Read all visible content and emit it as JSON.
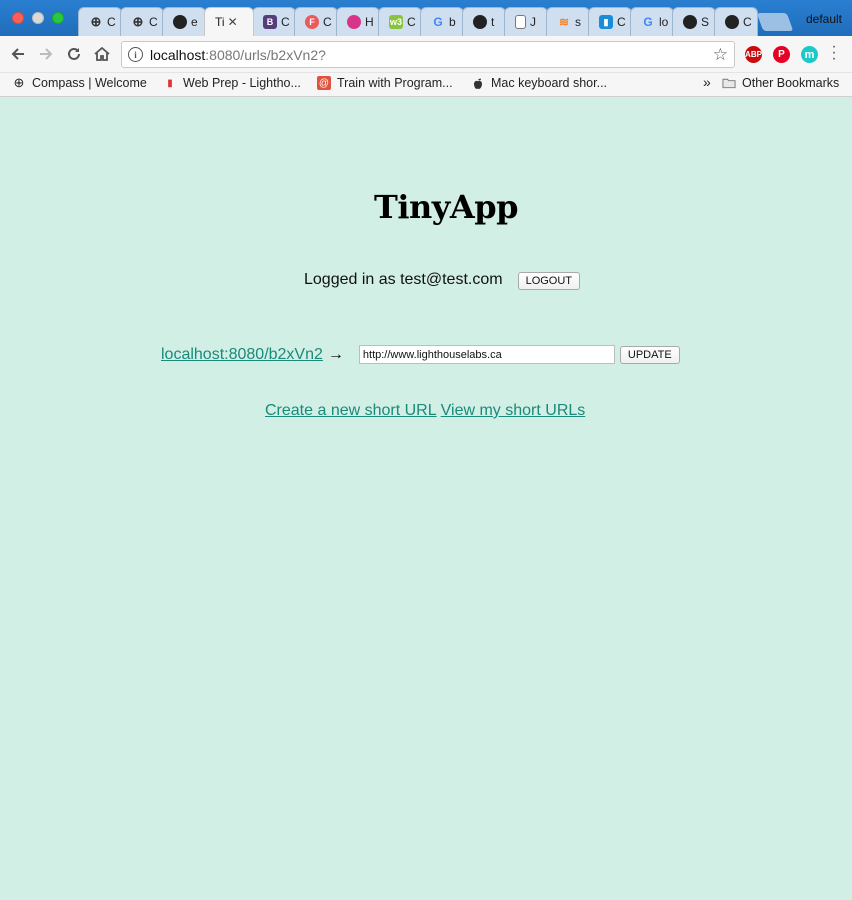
{
  "browser": {
    "tabs": [
      {
        "icon": "compass-icon",
        "label": "C"
      },
      {
        "icon": "compass-icon",
        "label": "C"
      },
      {
        "icon": "github-icon",
        "label": "e"
      },
      {
        "icon": "page-icon",
        "label": "Ti",
        "active": true
      },
      {
        "icon": "bootstrap-icon",
        "label": "C"
      },
      {
        "icon": "f-icon",
        "label": "C"
      },
      {
        "icon": "firefox-icon",
        "label": "H"
      },
      {
        "icon": "w3-icon",
        "label": "C"
      },
      {
        "icon": "google-icon",
        "label": "b"
      },
      {
        "icon": "github-icon",
        "label": "t"
      },
      {
        "icon": "document-icon",
        "label": "J"
      },
      {
        "icon": "stackoverflow-icon",
        "label": "s"
      },
      {
        "icon": "chart-icon",
        "label": "C"
      },
      {
        "icon": "google-icon",
        "label": "lo"
      },
      {
        "icon": "github-icon",
        "label": "S"
      },
      {
        "icon": "github-icon",
        "label": "C"
      }
    ],
    "active_tab_close": "✕",
    "profile_name": "default",
    "address": {
      "host": "localhost",
      "rest": ":8080/urls/b2xVn2?"
    },
    "info_glyph": "i",
    "extensions": [
      {
        "label": "ABP",
        "color": "#c70d0d"
      },
      {
        "label": "P",
        "color": "#e60023"
      },
      {
        "label": "m",
        "color": "#1ec8c8"
      }
    ],
    "bookmarks": [
      {
        "icon": "compass-icon",
        "label": "Compass | Welcome"
      },
      {
        "icon": "lighthouse-icon",
        "label": "Web Prep - Lightho..."
      },
      {
        "icon": "spiral-icon",
        "label": "Train with Program..."
      },
      {
        "icon": "apple-icon",
        "label": "Mac keyboard shor..."
      }
    ],
    "bookmarks_overflow": "»",
    "other_bookmarks": "Other Bookmarks"
  },
  "page": {
    "title": "TinyApp",
    "login_text": "Logged in as test@test.com",
    "logout_label": "LOGOUT",
    "short_url": "localhost:8080/b2xVn2",
    "arrow": "→",
    "long_url_value": "http://www.lighthouselabs.ca",
    "update_label": "UPDATE",
    "links": {
      "create": "Create a new short URL",
      "view": "View my short URLs"
    }
  },
  "colors": {
    "page_background": "#d2efe6",
    "link": "#1a8a7a",
    "titlebar": "#1f6dbb"
  }
}
